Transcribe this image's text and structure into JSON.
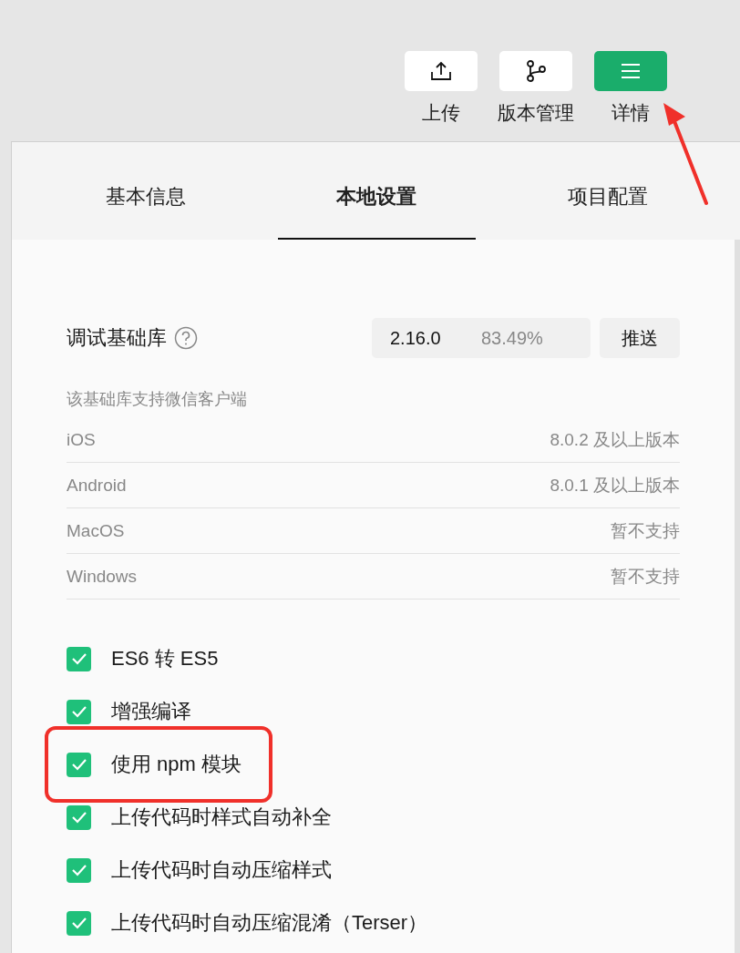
{
  "toolbar": [
    {
      "label": "上传",
      "primary": false
    },
    {
      "label": "版本管理",
      "primary": false
    },
    {
      "label": "详情",
      "primary": true,
      "callout_arrow": true
    }
  ],
  "tabs": [
    {
      "label": "基本信息",
      "selected": false
    },
    {
      "label": "本地设置",
      "selected": true
    },
    {
      "label": "项目配置",
      "selected": false
    }
  ],
  "debug_library": {
    "label": "调试基础库",
    "version": "2.16.0",
    "share": "83.49%",
    "push_button": "推送"
  },
  "support": {
    "title": "该基础库支持微信客户端",
    "rows": [
      {
        "platform": "iOS",
        "value": "8.0.2 及以上版本"
      },
      {
        "platform": "Android",
        "value": "8.0.1 及以上版本"
      },
      {
        "platform": "MacOS",
        "value": "暂不支持"
      },
      {
        "platform": "Windows",
        "value": "暂不支持"
      }
    ]
  },
  "options": [
    {
      "label": "ES6 转 ES5",
      "checked": true,
      "highlighted": false
    },
    {
      "label": "增强编译",
      "checked": true,
      "highlighted": false
    },
    {
      "label": "使用 npm 模块",
      "checked": true,
      "highlighted": true
    },
    {
      "label": "上传代码时样式自动补全",
      "checked": true,
      "highlighted": false
    },
    {
      "label": "上传代码时自动压缩样式",
      "checked": true,
      "highlighted": false
    },
    {
      "label": "上传代码时自动压缩混淆（Terser）",
      "checked": true,
      "highlighted": false
    }
  ]
}
